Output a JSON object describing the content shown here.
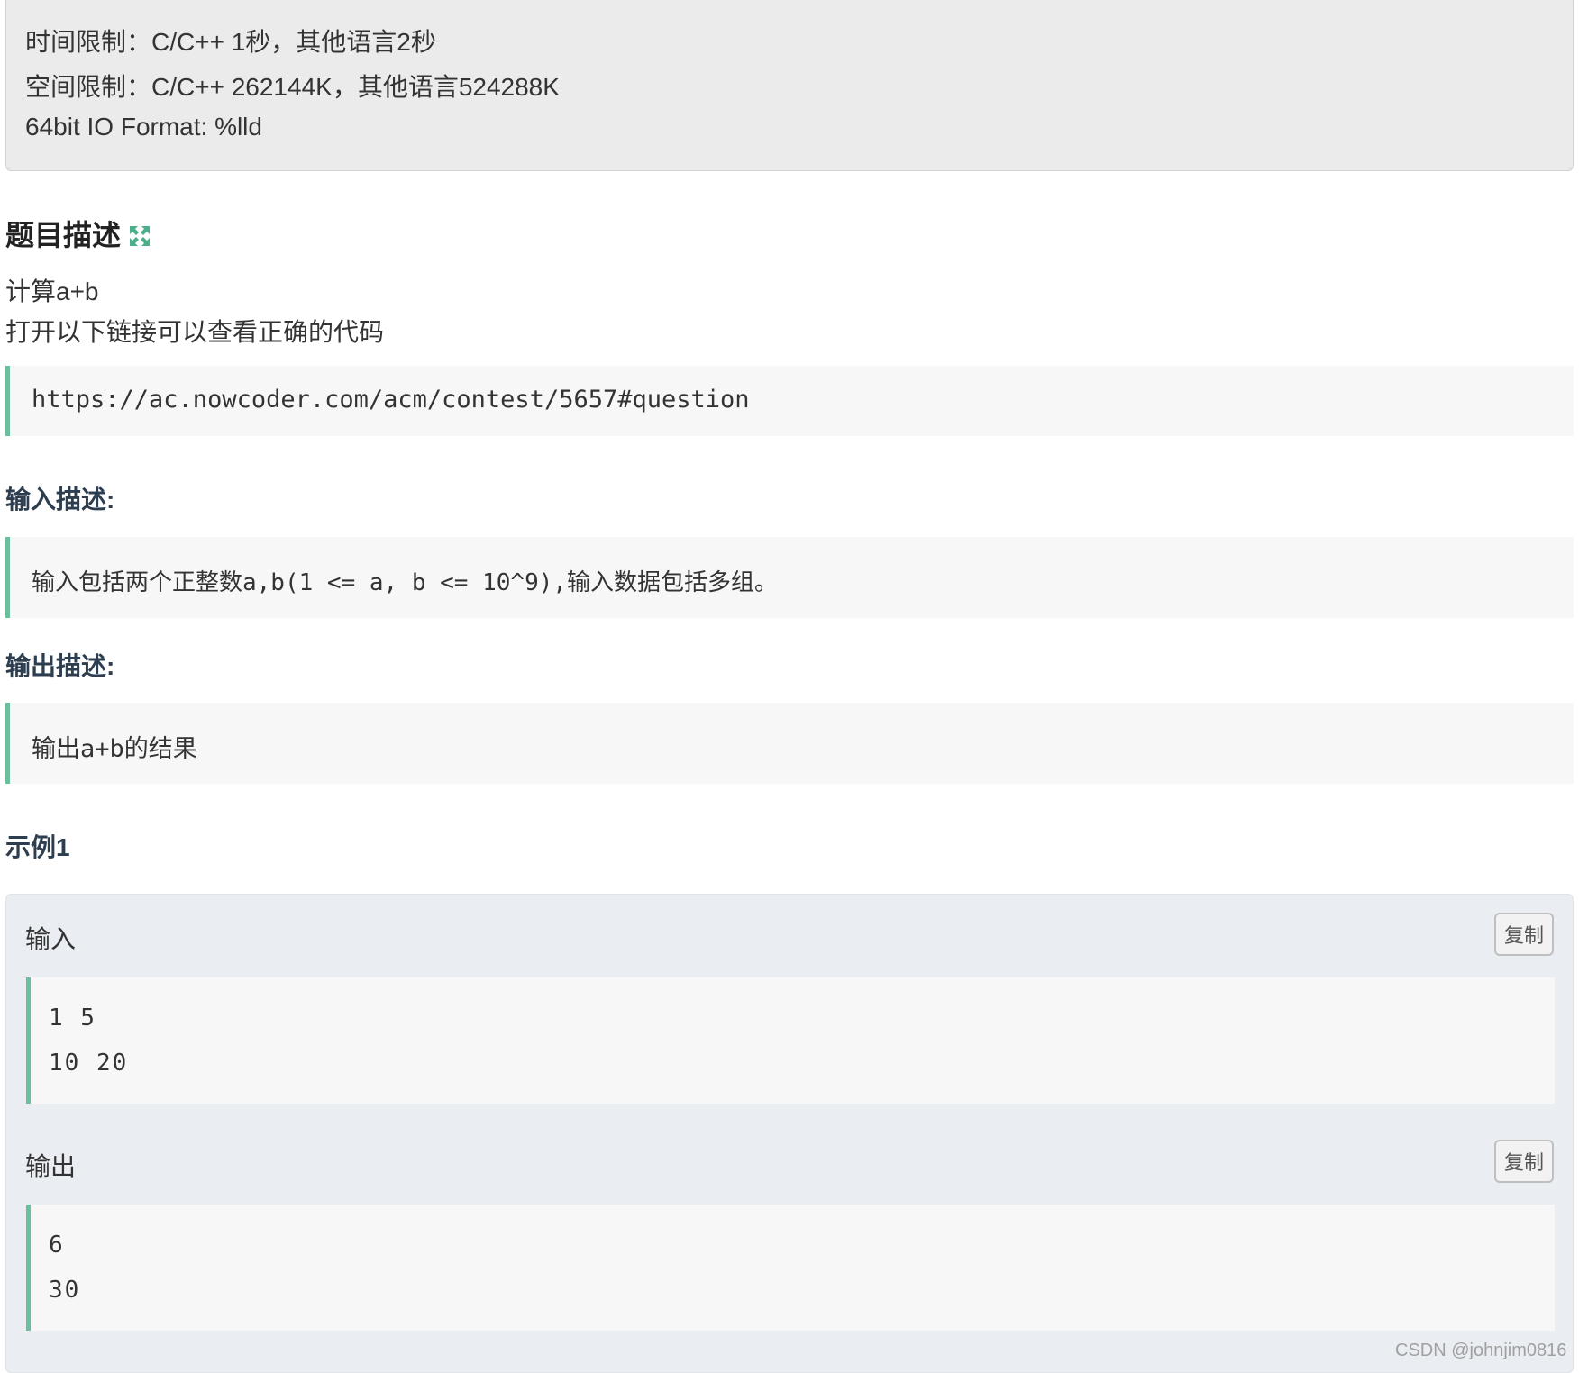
{
  "limits": {
    "time": "时间限制：C/C++ 1秒，其他语言2秒",
    "space": "空间限制：C/C++ 262144K，其他语言524288K",
    "io_format": "64bit IO Format: %lld"
  },
  "description": {
    "title": "题目描述",
    "icon": "expand-icon",
    "line1": "计算a+b",
    "line2": "打开以下链接可以查看正确的代码",
    "link": "https://ac.nowcoder.com/acm/contest/5657#question"
  },
  "input_desc": {
    "title": "输入描述:",
    "text": "输入包括两个正整数a,b(1 <= a, b <= 10^9),输入数据包括多组。"
  },
  "output_desc": {
    "title": "输出描述:",
    "text": "输出a+b的结果"
  },
  "example": {
    "title": "示例1",
    "input_label": "输入",
    "input_copy": "复制",
    "input_lines": [
      "1 5",
      "10 20"
    ],
    "output_label": "输出",
    "output_copy": "复制",
    "output_lines": [
      "6",
      "30"
    ]
  },
  "watermark": "CSDN @johnjim0816",
  "colors": {
    "accent": "#6cbf9d",
    "limits_bg": "#ebebeb",
    "example_bg": "#eaeef2"
  }
}
